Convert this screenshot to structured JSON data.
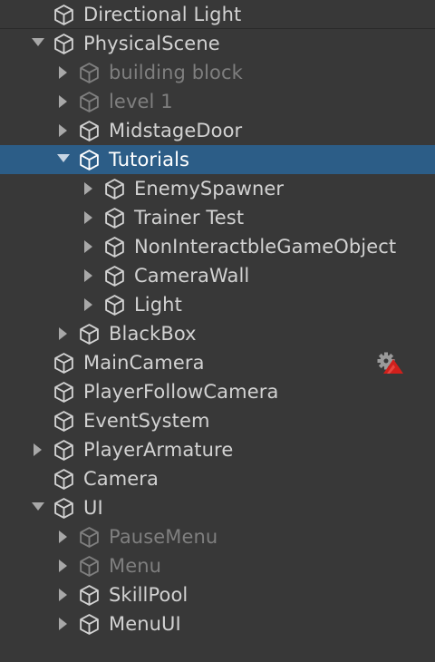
{
  "hierarchy": {
    "items": [
      {
        "label": "Directional Light",
        "depth": 0,
        "arrow": "none",
        "active": true,
        "selected": false
      },
      {
        "label": "PhysicalScene",
        "depth": 0,
        "arrow": "expanded",
        "active": true,
        "selected": false
      },
      {
        "label": "building block",
        "depth": 1,
        "arrow": "collapsed",
        "active": false,
        "selected": false
      },
      {
        "label": "level 1",
        "depth": 1,
        "arrow": "collapsed",
        "active": false,
        "selected": false
      },
      {
        "label": "MidstageDoor",
        "depth": 1,
        "arrow": "collapsed",
        "active": true,
        "selected": false
      },
      {
        "label": "Tutorials",
        "depth": 1,
        "arrow": "expanded",
        "active": true,
        "selected": true
      },
      {
        "label": "EnemySpawner",
        "depth": 2,
        "arrow": "collapsed",
        "active": true,
        "selected": false
      },
      {
        "label": "Trainer Test",
        "depth": 2,
        "arrow": "collapsed",
        "active": true,
        "selected": false
      },
      {
        "label": "NonInteractbleGameObject",
        "depth": 2,
        "arrow": "collapsed",
        "active": true,
        "selected": false
      },
      {
        "label": "CameraWall",
        "depth": 2,
        "arrow": "collapsed",
        "active": true,
        "selected": false
      },
      {
        "label": "Light",
        "depth": 2,
        "arrow": "collapsed",
        "active": true,
        "selected": false
      },
      {
        "label": "BlackBox",
        "depth": 1,
        "arrow": "collapsed",
        "active": true,
        "selected": false
      },
      {
        "label": "MainCamera",
        "depth": 0,
        "arrow": "none",
        "active": true,
        "selected": false,
        "badge": "gear-warning-icon"
      },
      {
        "label": "PlayerFollowCamera",
        "depth": 0,
        "arrow": "none",
        "active": true,
        "selected": false
      },
      {
        "label": "EventSystem",
        "depth": 0,
        "arrow": "none",
        "active": true,
        "selected": false
      },
      {
        "label": "PlayerArmature",
        "depth": 0,
        "arrow": "collapsed",
        "active": true,
        "selected": false
      },
      {
        "label": "Camera",
        "depth": 0,
        "arrow": "none",
        "active": true,
        "selected": false
      },
      {
        "label": "UI",
        "depth": 0,
        "arrow": "expanded",
        "active": true,
        "selected": false
      },
      {
        "label": "PauseMenu",
        "depth": 1,
        "arrow": "collapsed",
        "active": false,
        "selected": false
      },
      {
        "label": "Menu",
        "depth": 1,
        "arrow": "collapsed",
        "active": false,
        "selected": false
      },
      {
        "label": "SkillPool",
        "depth": 1,
        "arrow": "collapsed",
        "active": true,
        "selected": false
      },
      {
        "label": "MenuUI",
        "depth": 1,
        "arrow": "collapsed",
        "active": true,
        "selected": false
      }
    ]
  },
  "colors": {
    "background": "#383838",
    "selection": "#2c5d87",
    "text_active": "#d2d2d2",
    "text_inactive": "#7f7f7f",
    "badge_red": "#d0201c"
  }
}
